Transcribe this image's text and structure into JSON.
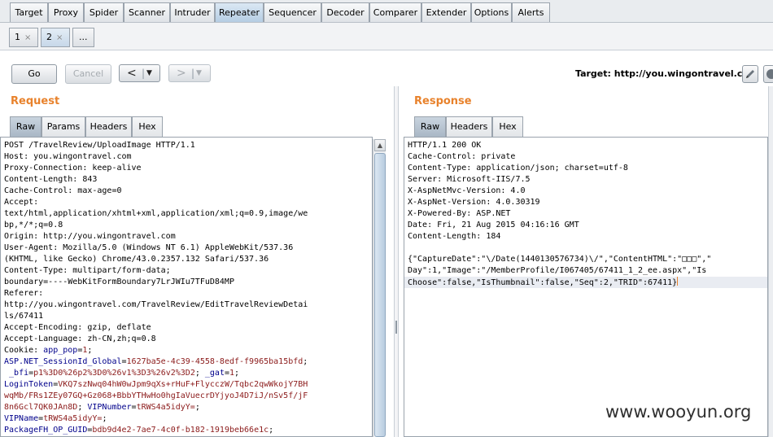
{
  "main_tabs": [
    {
      "label": "Target"
    },
    {
      "label": "Proxy"
    },
    {
      "label": "Spider"
    },
    {
      "label": "Scanner"
    },
    {
      "label": "Intruder"
    },
    {
      "label": "Repeater"
    },
    {
      "label": "Sequencer"
    },
    {
      "label": "Decoder"
    },
    {
      "label": "Comparer"
    },
    {
      "label": "Extender"
    },
    {
      "label": "Options"
    },
    {
      "label": "Alerts"
    }
  ],
  "repeater_tabs": [
    {
      "label": "1",
      "close": "×"
    },
    {
      "label": "2",
      "close": "×"
    },
    {
      "label": "..."
    }
  ],
  "toolbar": {
    "go_label": "Go",
    "cancel_label": "Cancel",
    "back_arrow": "<",
    "forward_arrow": ">",
    "dropdown_arrow": "▼",
    "target_label": "Target: http://you.wingontravel.com"
  },
  "request": {
    "title": "Request",
    "tabs": [
      "Raw",
      "Params",
      "Headers",
      "Hex"
    ],
    "lines": [
      [
        {
          "t": "POST /TravelReview/UploadImage HTTP/1.1"
        }
      ],
      [
        {
          "t": "Host: you.wingontravel.com"
        }
      ],
      [
        {
          "t": "Proxy-Connection: keep-alive"
        }
      ],
      [
        {
          "t": "Content-Length: 843"
        }
      ],
      [
        {
          "t": "Cache-Control: max-age=0"
        }
      ],
      [
        {
          "t": "Accept:"
        }
      ],
      [
        {
          "t": "text/html,application/xhtml+xml,application/xml;q=0.9,image/we"
        }
      ],
      [
        {
          "t": "bp,*/*;q=0.8"
        }
      ],
      [
        {
          "t": "Origin: http://you.wingontravel.com"
        }
      ],
      [
        {
          "t": "User-Agent: Mozilla/5.0 (Windows NT 6.1) AppleWebKit/537.36"
        }
      ],
      [
        {
          "t": "(KHTML, like Gecko) Chrome/43.0.2357.132 Safari/537.36"
        }
      ],
      [
        {
          "t": "Content-Type: multipart/form-data;"
        }
      ],
      [
        {
          "t": "boundary=----WebKitFormBoundary7LrJWIu7TFuD84MP"
        }
      ],
      [
        {
          "t": "Referer:"
        }
      ],
      [
        {
          "t": "http://you.wingontravel.com/TravelReview/EditTravelReviewDetai"
        }
      ],
      [
        {
          "t": "ls/67411"
        }
      ],
      [
        {
          "t": "Accept-Encoding: gzip, deflate"
        }
      ],
      [
        {
          "t": "Accept-Language: zh-CN,zh;q=0.8"
        }
      ],
      [
        {
          "t": "Cookie: "
        },
        {
          "t": "app_pop",
          "c": "ck"
        },
        {
          "t": "="
        },
        {
          "t": "1",
          "c": "cv"
        },
        {
          "t": ";"
        }
      ],
      [
        {
          "t": "ASP.NET_SessionId_Global",
          "c": "ck"
        },
        {
          "t": "="
        },
        {
          "t": "1627ba5e-4c39-4558-8edf-f9965ba15bfd",
          "c": "cv"
        },
        {
          "t": ";"
        }
      ],
      [
        {
          "t": " "
        },
        {
          "t": "_bfi",
          "c": "ck"
        },
        {
          "t": "="
        },
        {
          "t": "p1%3D0%26p2%3D0%26v1%3D3%26v2%3D2",
          "c": "cv"
        },
        {
          "t": "; "
        },
        {
          "t": "_gat",
          "c": "ck"
        },
        {
          "t": "="
        },
        {
          "t": "1",
          "c": "cv"
        },
        {
          "t": ";"
        }
      ],
      [
        {
          "t": "LoginToken",
          "c": "ck"
        },
        {
          "t": "="
        },
        {
          "t": "VKQ7szNwq04hW0wJpm9qXs+rHuF+FlycczW/Tqbc2qwWkojY7BH",
          "c": "cv"
        }
      ],
      [
        {
          "t": "wqMb/FRs1ZEy07GQ+Gz068+BbbYTHwHo0hgIaVuecrDYjyoJ4D7iJ/nSv5f/jF",
          "c": "cv"
        }
      ],
      [
        {
          "t": "8n6Gcl7QK0JAn8D",
          "c": "cv"
        },
        {
          "t": "; "
        },
        {
          "t": "VIPNumber",
          "c": "ck"
        },
        {
          "t": "="
        },
        {
          "t": "tRWS4a5idyY=",
          "c": "cv"
        },
        {
          "t": ";"
        }
      ],
      [
        {
          "t": "VIPName",
          "c": "ck"
        },
        {
          "t": "="
        },
        {
          "t": "tRWS4a5idyY=",
          "c": "cv"
        },
        {
          "t": ";"
        }
      ],
      [
        {
          "t": "PackageFH_OP_GUID",
          "c": "ck"
        },
        {
          "t": "="
        },
        {
          "t": "bdb9d4e2-7ae7-4c0f-b182-1919beb66e1c",
          "c": "cv"
        },
        {
          "t": ";"
        }
      ]
    ]
  },
  "response": {
    "title": "Response",
    "tabs": [
      "Raw",
      "Headers",
      "Hex"
    ],
    "lines": [
      [
        {
          "t": "HTTP/1.1 200 OK"
        }
      ],
      [
        {
          "t": "Cache-Control: private"
        }
      ],
      [
        {
          "t": "Content-Type: application/json; charset=utf-8"
        }
      ],
      [
        {
          "t": "Server: Microsoft-IIS/7.5"
        }
      ],
      [
        {
          "t": "X-AspNetMvc-Version: 4.0"
        }
      ],
      [
        {
          "t": "X-AspNet-Version: 4.0.30319"
        }
      ],
      [
        {
          "t": "X-Powered-By: ASP.NET"
        }
      ],
      [
        {
          "t": "Date: Fri, 21 Aug 2015 04:16:16 GMT"
        }
      ],
      [
        {
          "t": "Content-Length: 184"
        }
      ],
      [
        {
          "t": ""
        }
      ],
      [
        {
          "t": "{\"CaptureDate\":\"\\/Date(1440130576734)\\/\",\"ContentHTML\":\"□□□\",\""
        }
      ],
      [
        {
          "t": "Day\":1,\"Image\":\"/MemberProfile/I067405/67411_1_2_ee.aspx\",\"Is"
        }
      ],
      [
        {
          "t": "Choose\":false,\"IsThumbnail\":false,\"Seq\":2,\"TRID\":67411}"
        }
      ]
    ]
  },
  "watermark": "www.wooyun.org",
  "icons": {
    "edit": "pencil-icon",
    "help": "question-icon"
  }
}
